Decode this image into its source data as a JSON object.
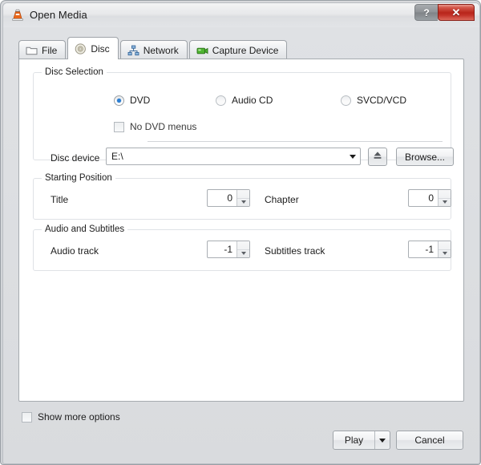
{
  "window": {
    "title": "Open Media",
    "app_icon": "vlc-cone-icon",
    "help_label": "?",
    "close_label": "✕"
  },
  "tabs": [
    {
      "label": "File",
      "icon": "folder-icon",
      "active": false
    },
    {
      "label": "Disc",
      "icon": "disc-icon",
      "active": true
    },
    {
      "label": "Network",
      "icon": "network-icon",
      "active": false
    },
    {
      "label": "Capture Device",
      "icon": "capture-card-icon",
      "active": false
    }
  ],
  "disc_selection": {
    "title": "Disc Selection",
    "options": [
      {
        "label": "DVD",
        "selected": true
      },
      {
        "label": "Audio CD",
        "selected": false
      },
      {
        "label": "SVCD/VCD",
        "selected": false
      }
    ],
    "no_dvd_menus": {
      "label": "No DVD menus",
      "checked": false
    },
    "device_label": "Disc device",
    "device_value": "E:\\",
    "eject_icon": "eject-icon",
    "browse_label": "Browse..."
  },
  "starting_position": {
    "title": "Starting Position",
    "title_label": "Title",
    "title_value": "0",
    "chapter_label": "Chapter",
    "chapter_value": "0"
  },
  "audio_subtitles": {
    "title": "Audio and Subtitles",
    "audio_label": "Audio track",
    "audio_value": "-1",
    "subtitles_label": "Subtitles track",
    "subtitles_value": "-1"
  },
  "footer": {
    "show_more_options": {
      "label": "Show more options",
      "checked": false
    },
    "play_label": "Play",
    "cancel_label": "Cancel"
  },
  "colors": {
    "accent_blue": "#2b7fd4",
    "close_red": "#b8251a",
    "panel_bg": "#ffffff",
    "dialog_bg": "#dfe1e4"
  }
}
